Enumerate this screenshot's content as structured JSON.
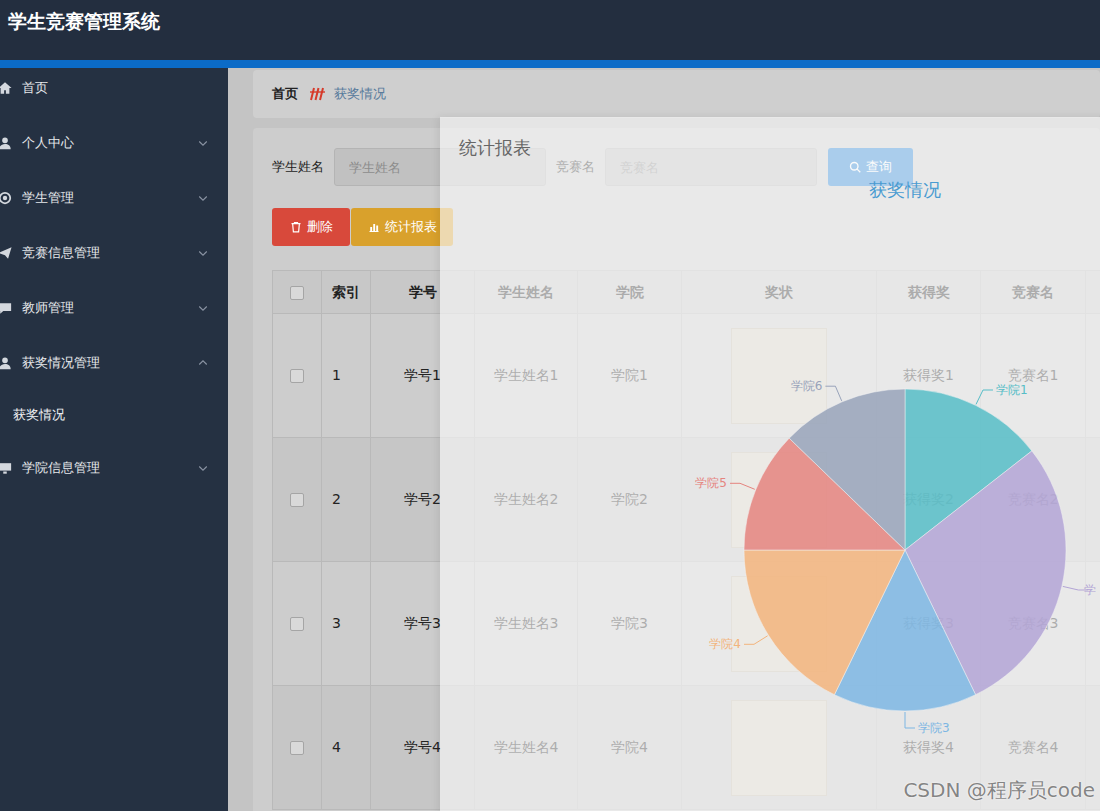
{
  "header": {
    "title": "学生竞赛管理系统"
  },
  "sidebar": {
    "items": [
      {
        "label": "首页",
        "kind": "link",
        "expanded": false,
        "children": []
      },
      {
        "label": "个人中心",
        "kind": "group",
        "expanded": false,
        "children": []
      },
      {
        "label": "学生管理",
        "kind": "group",
        "expanded": false,
        "children": []
      },
      {
        "label": "竞赛信息管理",
        "kind": "group",
        "expanded": false,
        "children": []
      },
      {
        "label": "教师管理",
        "kind": "group",
        "expanded": false,
        "children": []
      },
      {
        "label": "获奖情况管理",
        "kind": "group",
        "expanded": true,
        "children": [
          {
            "label": "获奖情况"
          }
        ]
      },
      {
        "label": "学院信息管理",
        "kind": "group",
        "expanded": false,
        "children": []
      }
    ]
  },
  "breadcrumb": [
    {
      "label": "首页"
    },
    {
      "label": "获奖情况"
    }
  ],
  "search": {
    "fields": [
      {
        "label": "学生姓名",
        "placeholder": "学生姓名"
      },
      {
        "label": "竞赛名",
        "placeholder": "竞赛名"
      }
    ],
    "button": "查询"
  },
  "actions": [
    {
      "label": "删除",
      "kind": "danger"
    },
    {
      "label": "统计报表",
      "kind": "warning"
    }
  ],
  "table": {
    "all_checked": false,
    "columns": [
      "索引",
      "学号",
      "学生姓名",
      "学院",
      "奖状",
      "获得奖",
      "竞赛名"
    ],
    "rows": [
      {
        "checked": false,
        "index": "1",
        "student_id": "学号1",
        "student_name": "学生姓名1",
        "college": "学院1",
        "award": "获得奖1",
        "competition": "竞赛名1"
      },
      {
        "checked": false,
        "index": "2",
        "student_id": "学号2",
        "student_name": "学生姓名2",
        "college": "学院2",
        "award": "获得奖2",
        "competition": "竞赛名2"
      },
      {
        "checked": false,
        "index": "3",
        "student_id": "学号3",
        "student_name": "学生姓名3",
        "college": "学院3",
        "award": "获得奖3",
        "competition": "竞赛名3"
      },
      {
        "checked": false,
        "index": "4",
        "student_id": "学号4",
        "student_name": "学生姓名4",
        "college": "学院4",
        "award": "获得奖4",
        "competition": "竞赛名4"
      }
    ]
  },
  "modal": {
    "title": "统计报表",
    "chart": {
      "title": "获奖情况",
      "series": [
        {
          "label": "学院1",
          "value": 52,
          "color": "#56bdc7"
        },
        {
          "label": "学",
          "value": 102,
          "color": "#b3a5d6"
        },
        {
          "label": "学院3",
          "value": 52,
          "color": "#7db6e3"
        },
        {
          "label": "学院4",
          "value": 64,
          "color": "#f3b47c"
        },
        {
          "label": "学院5",
          "value": 44,
          "color": "#e5847f"
        },
        {
          "label": "学院6",
          "value": 46,
          "color": "#98a3ba"
        }
      ]
    }
  },
  "watermark": "CSDN @程序员code"
}
